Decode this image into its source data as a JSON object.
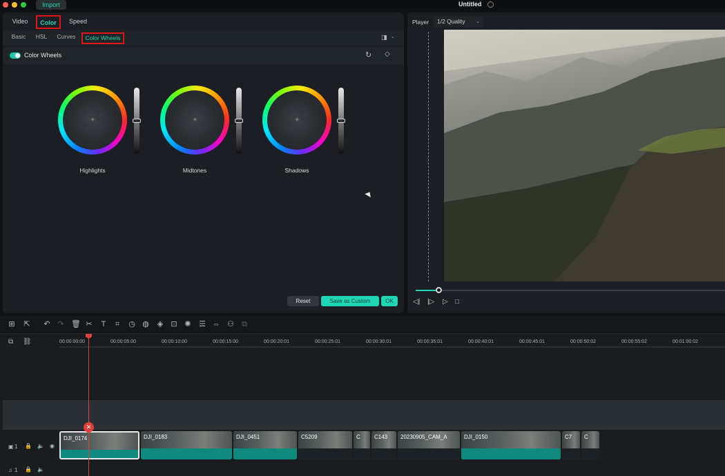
{
  "titlebar": {
    "import_tab": "Import",
    "doc_title": "Untitled",
    "traffic_colors": [
      "#ff5f57",
      "#febc2e",
      "#28c840"
    ]
  },
  "left_panel": {
    "tabs": [
      "Video",
      "Color",
      "Speed"
    ],
    "active_tab": "Color",
    "subtabs": [
      "Basic",
      "HSL",
      "Curves",
      "Color Wheels"
    ],
    "active_subtab": "Color Wheels",
    "section_title": "Color Wheels",
    "wheels": [
      {
        "label": "Highlights"
      },
      {
        "label": "Midtones"
      },
      {
        "label": "Shadows"
      }
    ],
    "buttons": {
      "reset": "Reset",
      "save_custom": "Save as Custom",
      "ok": "OK"
    }
  },
  "player": {
    "label": "Player",
    "quality": "1/2 Quality"
  },
  "timeline": {
    "ruler": [
      "00:00:00:00",
      "00:00:05:00",
      "00:00:10:00",
      "00:00:15:00",
      "00:00:20:01",
      "00:00:25:01",
      "00:00:30:01",
      "00:00:35:01",
      "00:00:40:01",
      "00:00:45:01",
      "00:00:50:02",
      "00:00:55:02",
      "00:01:00:02"
    ],
    "clips": [
      {
        "name": "DJI_0174"
      },
      {
        "name": "DJI_0183"
      },
      {
        "name": "DJI_0451"
      },
      {
        "name": "C5209"
      },
      {
        "name": "C"
      },
      {
        "name": "C143"
      },
      {
        "name": "20230905_CAM_A"
      },
      {
        "name": "DJI_0150"
      },
      {
        "name": "C7"
      },
      {
        "name": "C"
      }
    ],
    "track_labels": {
      "video": "1",
      "audio": "1"
    }
  },
  "colors": {
    "accent": "#1fd6b5",
    "highlight_border": "#e01616",
    "playhead": "#e0403a"
  }
}
